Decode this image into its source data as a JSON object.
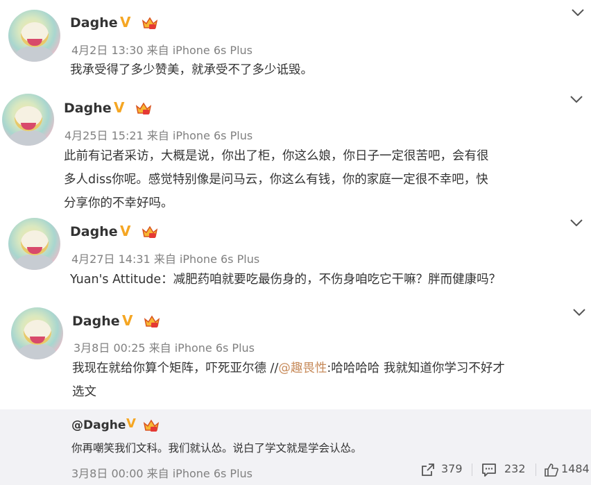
{
  "posts": [
    {
      "name": "Daghe",
      "verified": "V",
      "meta": "4月2日 13:30 来自 iPhone 6s Plus",
      "lines": [
        "我承受得了多少赞美，就承受不了多少诋毁。"
      ]
    },
    {
      "name": "Daghe",
      "verified": "V",
      "meta": "4月25日 15:21 来自 iPhone 6s Plus",
      "lines": [
        "此前有记者采访，大概是说，你出了柜，你这么娘，你日子一定很苦吧，会有很",
        "多人diss你呢。感觉特别像是问马云，你这么有钱，你的家庭一定很不幸吧，快",
        "分享你的不幸好吗。"
      ]
    },
    {
      "name": "Daghe",
      "verified": "V",
      "meta": "4月27日 14:31 来自 iPhone 6s Plus",
      "lines": [
        "Yuan's Attitude：减肥药咱就要吃最伤身的，不伤身咱吃它干嘛？胖而健康吗？"
      ]
    },
    {
      "name": "Daghe",
      "verified": "V",
      "meta": "3月8日 00:25 来自 iPhone 6s Plus",
      "line1_prefix": "我现在就给你算个矩阵，吓死亚尔德 //",
      "line1_mention": "@趣畏性",
      "line1_suffix": ":哈哈哈哈 我就知道你学习不好才",
      "line2": "选文"
    }
  ],
  "repost": {
    "name": "@Daghe",
    "verified": "V",
    "text": "你再嘲笑我们文科。我们就认怂。说白了学文就是学会认怂。",
    "meta": "3月8日 00:00 来自 iPhone 6s Plus",
    "share_count": "379",
    "comment_count": "232",
    "like_count": "1484"
  },
  "colors": {
    "verified": "#f5a623",
    "mention": "#c78b5b",
    "repost_bg": "#f2f2f5"
  },
  "icons": {
    "menu": "chevron-down-icon",
    "share": "share-icon",
    "comment": "comment-icon",
    "like": "like-icon",
    "vip": "crown-badge-icon"
  }
}
